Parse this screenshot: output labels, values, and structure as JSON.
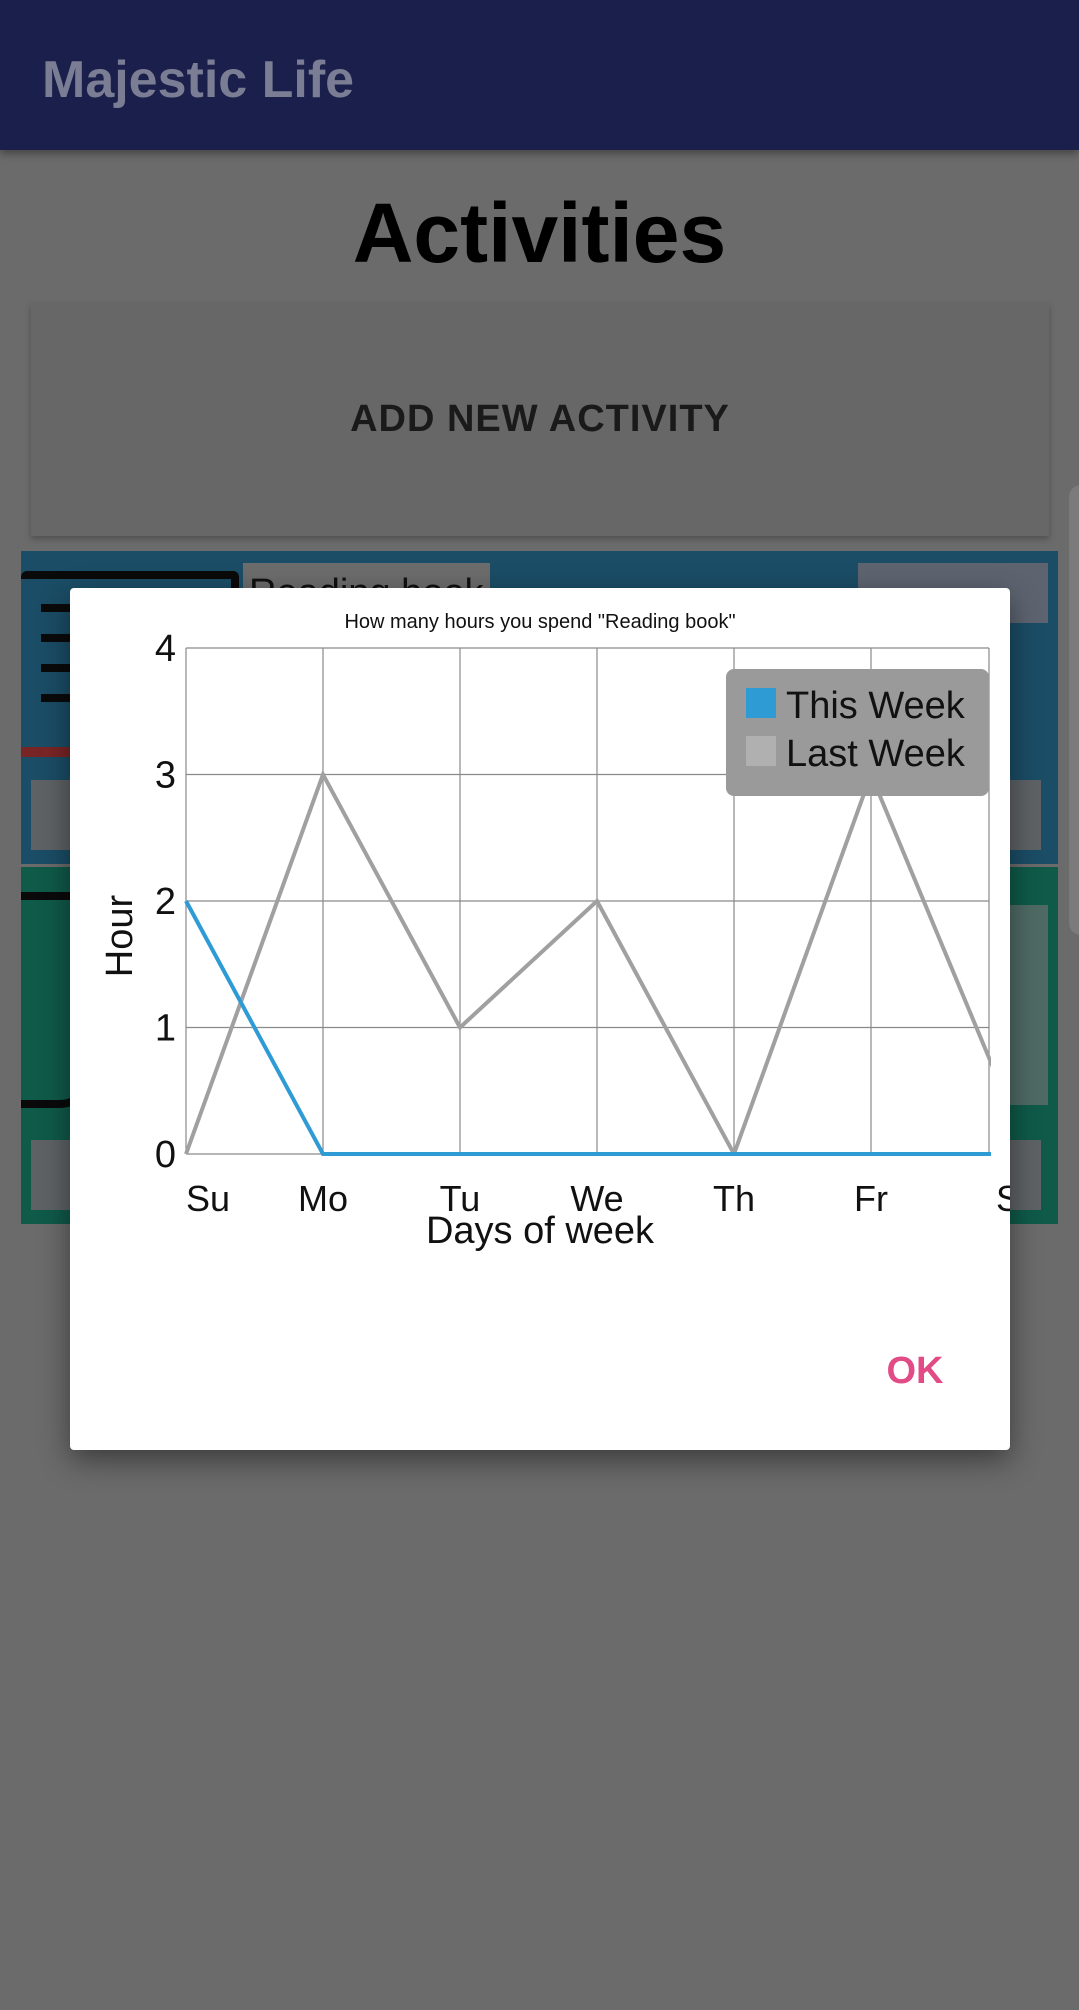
{
  "app": {
    "title": "Majestic Life"
  },
  "page": {
    "title": "Activities"
  },
  "buttons": {
    "add_activity": "ADD NEW ACTIVITY",
    "ok": "OK"
  },
  "activities": [
    {
      "label": "Reading book"
    }
  ],
  "colors": {
    "app_bar": "#1a1f4b",
    "this_week": "#2e9bd5",
    "last_week": "#a0a0a0",
    "ok_button": "#e24b86"
  },
  "chart_data": {
    "type": "line",
    "title": "How many hours you spend \"Reading book\"",
    "xlabel": "Days of week",
    "ylabel": "Hour",
    "categories": [
      "Su",
      "Mo",
      "Tu",
      "We",
      "Th",
      "Fr",
      "S"
    ],
    "ylim": [
      0,
      4
    ],
    "yticks": [
      "0",
      "1",
      "2",
      "3",
      "4"
    ],
    "grid": true,
    "legend_position": "top-right",
    "series": [
      {
        "name": "This Week",
        "color": "#2e9bd5",
        "values": [
          2,
          0,
          0,
          0,
          0,
          0,
          0
        ]
      },
      {
        "name": "Last Week",
        "color": "#a0a0a0",
        "values": [
          0,
          3,
          1,
          2,
          0,
          3,
          0.4
        ]
      }
    ]
  }
}
